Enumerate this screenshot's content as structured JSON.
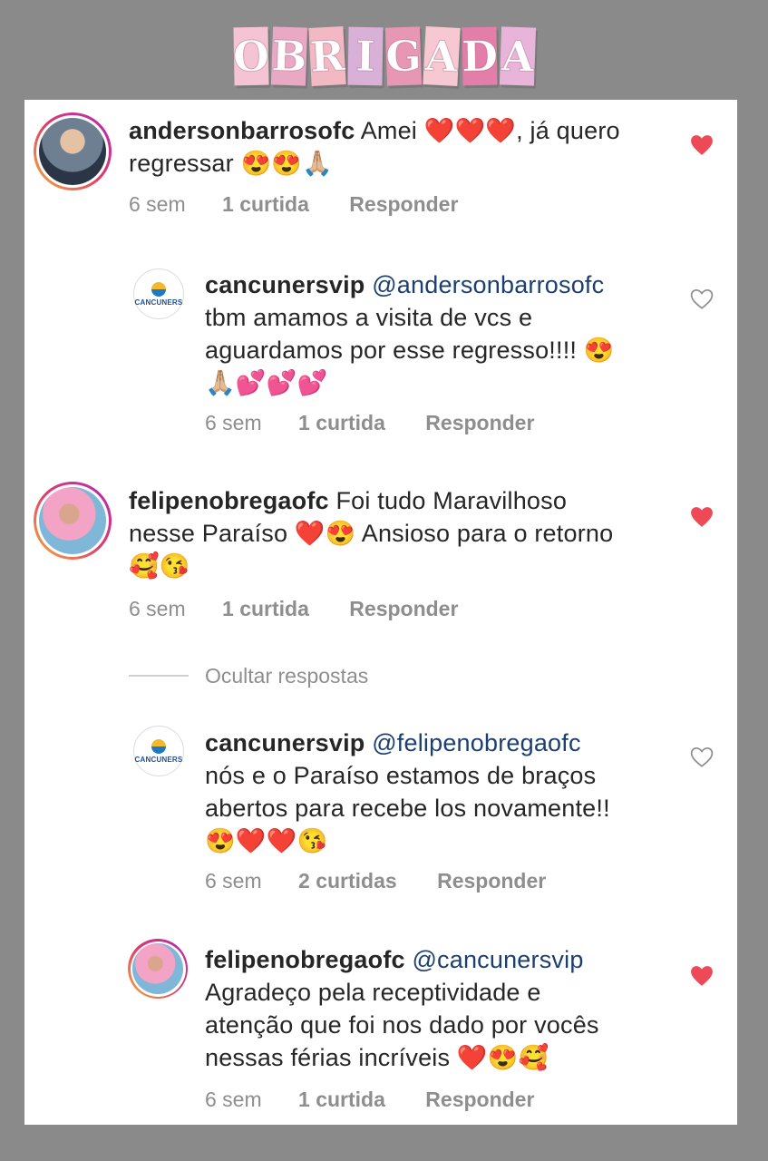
{
  "title_letters": [
    {
      "ch": "O",
      "bg": "#f4c3d4"
    },
    {
      "ch": "B",
      "bg": "#e9a9c5"
    },
    {
      "ch": "R",
      "bg": "#f2b8c4"
    },
    {
      "ch": "I",
      "bg": "#d8b0d8"
    },
    {
      "ch": "G",
      "bg": "#e796b4"
    },
    {
      "ch": "A",
      "bg": "#f6c8d2"
    },
    {
      "ch": "D",
      "bg": "#e27ea8"
    },
    {
      "ch": "A",
      "bg": "#e9b4d9"
    }
  ],
  "comments": [
    {
      "user": "andersonbarrosofc",
      "mention": "",
      "text_lines": [
        "Amei ❤️❤️❤️, já quero",
        "regressar 😍😍🙏🏼"
      ],
      "time": "6 sem",
      "likes": "1 curtida",
      "reply": "Responder",
      "liked": true
    },
    {
      "user": "cancunersvip",
      "mention": "@andersonbarrosofc",
      "text_lines": [
        "tbm amamos a visita de vcs e",
        "aguardamos por esse regresso!!!! 😍",
        "🙏🏼💕💕💕"
      ],
      "time": "6 sem",
      "likes": "1 curtida",
      "reply": "Responder",
      "liked": false
    },
    {
      "user": "felipenobregaofc",
      "mention": "",
      "text_lines": [
        "Foi tudo Maravilhoso",
        "nesse Paraíso ❤️😍 Ansioso para o retorno",
        "🥰😘"
      ],
      "time": "6 sem",
      "likes": "1 curtida",
      "reply": "Responder",
      "liked": true
    },
    {
      "user": "cancunersvip",
      "mention": "@felipenobregaofc",
      "text_lines": [
        "nós e o Paraíso estamos de braços",
        "abertos para recebe los novamente!!",
        "😍❤️❤️😘"
      ],
      "time": "6 sem",
      "likes": "2 curtidas",
      "reply": "Responder",
      "liked": false
    },
    {
      "user": "felipenobregaofc",
      "mention": "@cancunersvip",
      "text_lines": [
        "Agradeço pela receptividade e",
        "atenção que foi nos dado por vocês",
        "nessas férias incríveis ❤️😍🥰"
      ],
      "time": "6 sem",
      "likes": "1 curtida",
      "reply": "Responder",
      "liked": true
    }
  ],
  "hide_replies": "Ocultar respostas",
  "logo_label": "CANCUNERS",
  "colors": {
    "heart_filled": "#ed4956",
    "heart_empty": "#8e8e8e",
    "mention": "#1c3f72"
  }
}
